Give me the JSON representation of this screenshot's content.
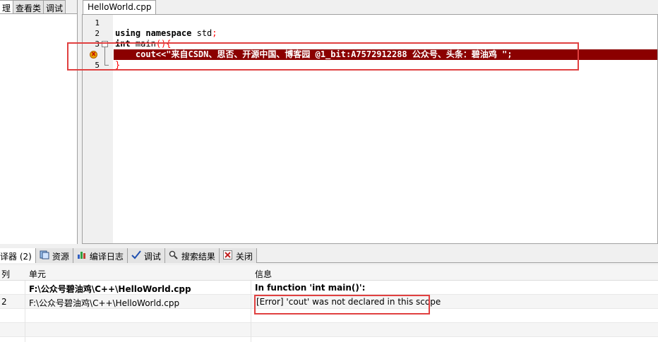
{
  "left_panel": {
    "tabs": [
      "理",
      "查看类",
      "调试"
    ]
  },
  "editor": {
    "file_tab": "HelloWorld.cpp",
    "line_numbers": [
      "1",
      "2",
      "3",
      "4",
      "5"
    ],
    "lines": {
      "l2_kw": "using namespace",
      "l2_rest": " std",
      "l2_semi": ";",
      "l3_kw": "int",
      "l3_rest": " main",
      "l3_sym": "(){",
      "l4_text": "    cout<<\"来自CSDN、思否、开源中国、博客园 @1_bit:A7572912288 公众号、头条：碧油鸡 \";",
      "l5_sym": "}"
    },
    "error_marker": "x"
  },
  "bottom_panel": {
    "tabs": [
      {
        "label": "译器 (2)",
        "icon": "compiler-icon"
      },
      {
        "label": "资源",
        "icon": "resources-icon"
      },
      {
        "label": "编译日志",
        "icon": "bar-chart-icon"
      },
      {
        "label": "调试",
        "icon": "checkmark-icon"
      },
      {
        "label": "搜索结果",
        "icon": "search-icon"
      },
      {
        "label": "关闭",
        "icon": "close-icon"
      }
    ],
    "columns": [
      "列",
      "单元",
      "信息"
    ],
    "rows": [
      {
        "line": "",
        "unit": "F:\\公众号碧油鸡\\C++\\HelloWorld.cpp",
        "message": "In function 'int main()':",
        "bold": true
      },
      {
        "line": "2",
        "unit": "F:\\公众号碧油鸡\\C++\\HelloWorld.cpp",
        "message": "[Error] 'cout' was not declared in this scope",
        "bold": false
      }
    ]
  },
  "colors": {
    "error_line_bg": "#8b0000",
    "highlight_box": "#e04040"
  }
}
